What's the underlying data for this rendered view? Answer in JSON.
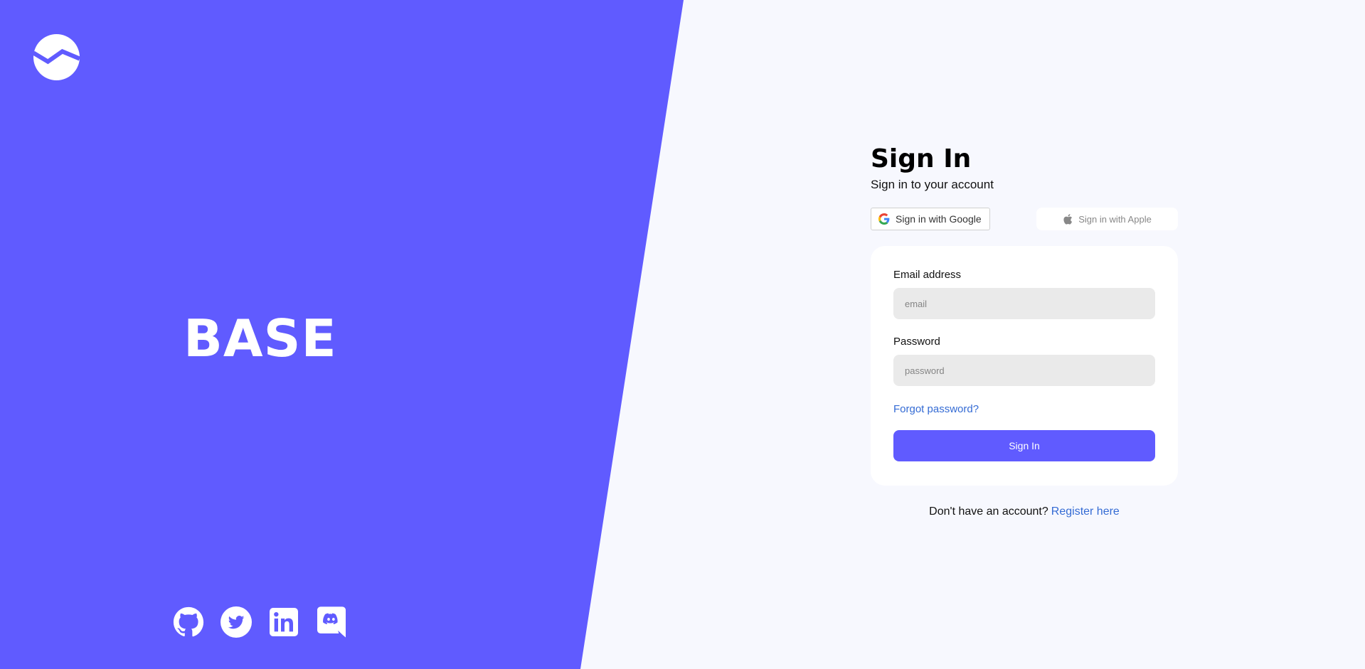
{
  "brand": {
    "name": "BASE",
    "color": "#605bff"
  },
  "socials": [
    {
      "icon": "github-icon"
    },
    {
      "icon": "twitter-icon"
    },
    {
      "icon": "linkedin-icon"
    },
    {
      "icon": "discord-icon"
    }
  ],
  "signin": {
    "title": "Sign In",
    "subtitle": "Sign in to your account",
    "google_label": "Sign in with Google",
    "apple_label": "Sign in with Apple"
  },
  "form": {
    "email_label": "Email address",
    "email_placeholder": "email",
    "email_value": "",
    "password_label": "Password",
    "password_placeholder": "password",
    "password_value": "",
    "forgot_label": "Forgot password?",
    "submit_label": "Sign In"
  },
  "footer": {
    "prompt": "Don't have an account?",
    "register_label": "Register here"
  }
}
